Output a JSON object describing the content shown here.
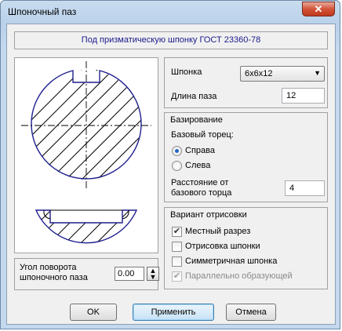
{
  "window": {
    "title": "Шпоночный паз",
    "close_glyph": "✕"
  },
  "banner": "Под призматическую шпонку ГОСТ 23360-78",
  "key": {
    "label": "Шпонка",
    "selected": "6x6x12",
    "slot_length_label": "Длина паза",
    "slot_length_value": "12"
  },
  "basing": {
    "title": "Базирование",
    "base_end_label": "Базовый торец:",
    "options": [
      {
        "label": "Справа",
        "checked": true
      },
      {
        "label": "Слева",
        "checked": false
      }
    ],
    "distance_label": "Расстояние от базового торца",
    "distance_value": "4"
  },
  "drawing_variant": {
    "title": "Вариант отрисовки",
    "options": [
      {
        "label": "Местный разрез",
        "checked": true,
        "enabled": true
      },
      {
        "label": "Отрисовка шпонки",
        "checked": false,
        "enabled": true
      },
      {
        "label": "Симметричная шпонка",
        "checked": false,
        "enabled": true
      },
      {
        "label": "Параллельно образующей",
        "checked": true,
        "enabled": false
      }
    ]
  },
  "angle": {
    "label": "Угол поворота шпоночного паза",
    "value": "0.00"
  },
  "buttons": {
    "ok": "OK",
    "apply": "Применить",
    "cancel": "Отмена"
  },
  "colors": {
    "outline": "#1f1f8f",
    "accent": "#2466c6"
  }
}
